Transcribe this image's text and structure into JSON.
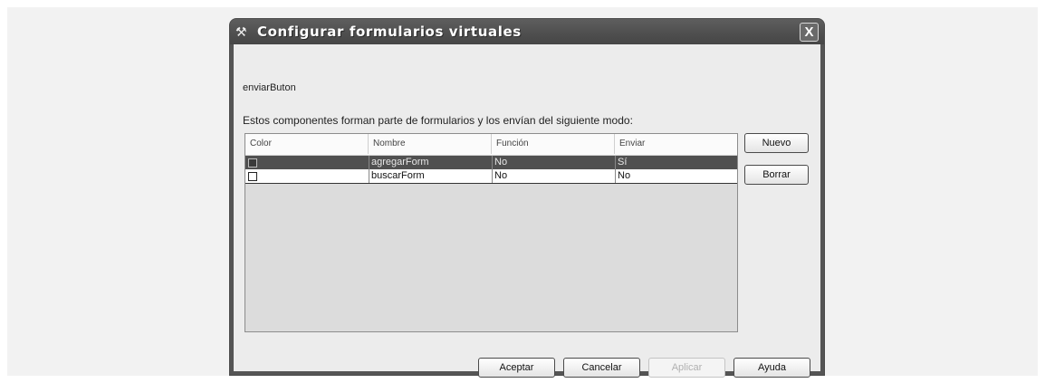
{
  "dialog": {
    "title": "Configurar formularios virtuales",
    "close_label": "X"
  },
  "component_name": "enviarButon",
  "description": "Estos componentes forman parte de formularios y los envían del siguiente modo:",
  "table": {
    "columns": [
      "Color",
      "Nombre",
      "Función",
      "Enviar"
    ],
    "rows": [
      {
        "name": "agregarForm",
        "funcion": "No",
        "enviar": "Sí",
        "selected": true
      },
      {
        "name": "buscarForm",
        "funcion": "No",
        "enviar": "No",
        "selected": false
      }
    ]
  },
  "side_buttons": {
    "nuevo": "Nuevo",
    "borrar": "Borrar"
  },
  "footer_buttons": {
    "aceptar": "Aceptar",
    "cancelar": "Cancelar",
    "aplicar": "Aplicar",
    "ayuda": "Ayuda"
  },
  "icons": {
    "title_icon": "tools-icon",
    "close_icon": "close-icon"
  }
}
